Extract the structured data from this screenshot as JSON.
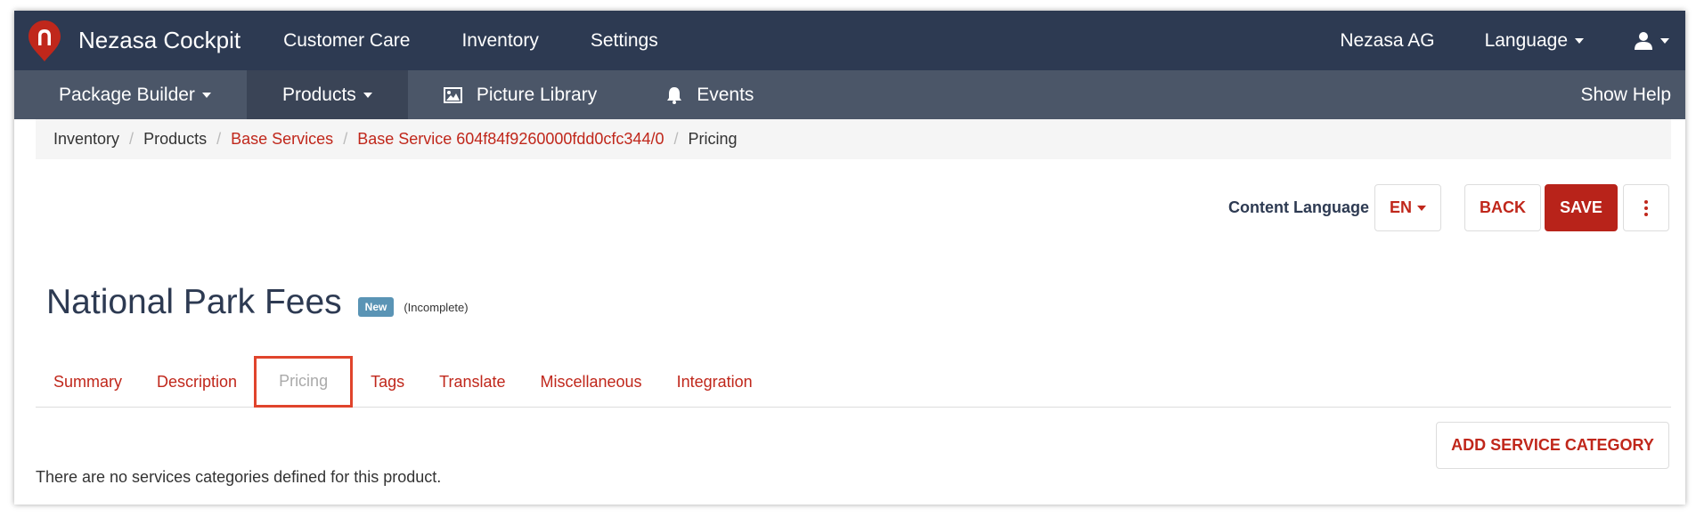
{
  "app": {
    "title": "Nezasa Cockpit",
    "brand_color": "#c0271b",
    "topbar_color": "#2d3a52",
    "subnav_color": "#4b5668"
  },
  "topnav": {
    "items": [
      "Customer Care",
      "Inventory",
      "Settings"
    ],
    "company": "Nezasa AG",
    "language": "Language"
  },
  "subnav": {
    "items": [
      {
        "label": "Package Builder",
        "icon": "none"
      },
      {
        "label": "Products",
        "icon": "none"
      },
      {
        "label": "Picture Library",
        "icon": "picture-icon"
      },
      {
        "label": "Events",
        "icon": "bell-icon"
      }
    ],
    "help": "Show Help"
  },
  "breadcrumb": [
    {
      "label": "Inventory"
    },
    {
      "label": "Products"
    },
    {
      "label": "Base Services"
    },
    {
      "label": "Base Service 604f84f9260000fdd0cfc344/0"
    },
    {
      "label": "Pricing"
    }
  ],
  "actions": {
    "content_language_label": "Content Language",
    "language_value": "EN",
    "back": "BACK",
    "save": "SAVE"
  },
  "page": {
    "title": "National Park Fees",
    "badge": "New",
    "status": "(Incomplete)"
  },
  "tabs": [
    "Summary",
    "Description",
    "Pricing",
    "Tags",
    "Translate",
    "Miscellaneous",
    "Integration"
  ],
  "active_tab": "Pricing",
  "pricing": {
    "add_button": "ADD SERVICE CATEGORY",
    "empty_message": "There are no services categories defined for this product."
  }
}
